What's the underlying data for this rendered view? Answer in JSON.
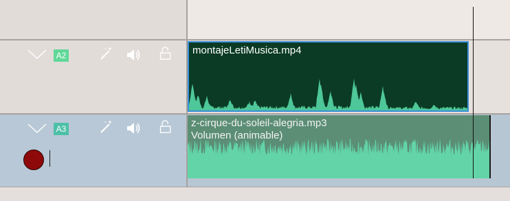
{
  "tracks": [
    {
      "badge": "A2",
      "badge_color": "#5fd898",
      "clip": {
        "title": "montajeLetiMusica.mp4",
        "selected": true
      }
    },
    {
      "badge": "A3",
      "badge_color": "#4ec0a8",
      "clip": {
        "title": "z-cirque-du-soleil-alegria.mp3",
        "subtitle": "Volumen (animable)"
      },
      "record_armed": true
    }
  ],
  "icons": [
    "chevron-down-icon",
    "magic-wand-icon",
    "speaker-icon",
    "lock-open-icon",
    "record-icon"
  ],
  "colors": {
    "clip_a2_bg": "#0b3b25",
    "clip_a3_bg": "#5b8e74",
    "waveform": "#4ec79a",
    "selection": "#3a8fd8",
    "record": "#8e0a0a"
  }
}
